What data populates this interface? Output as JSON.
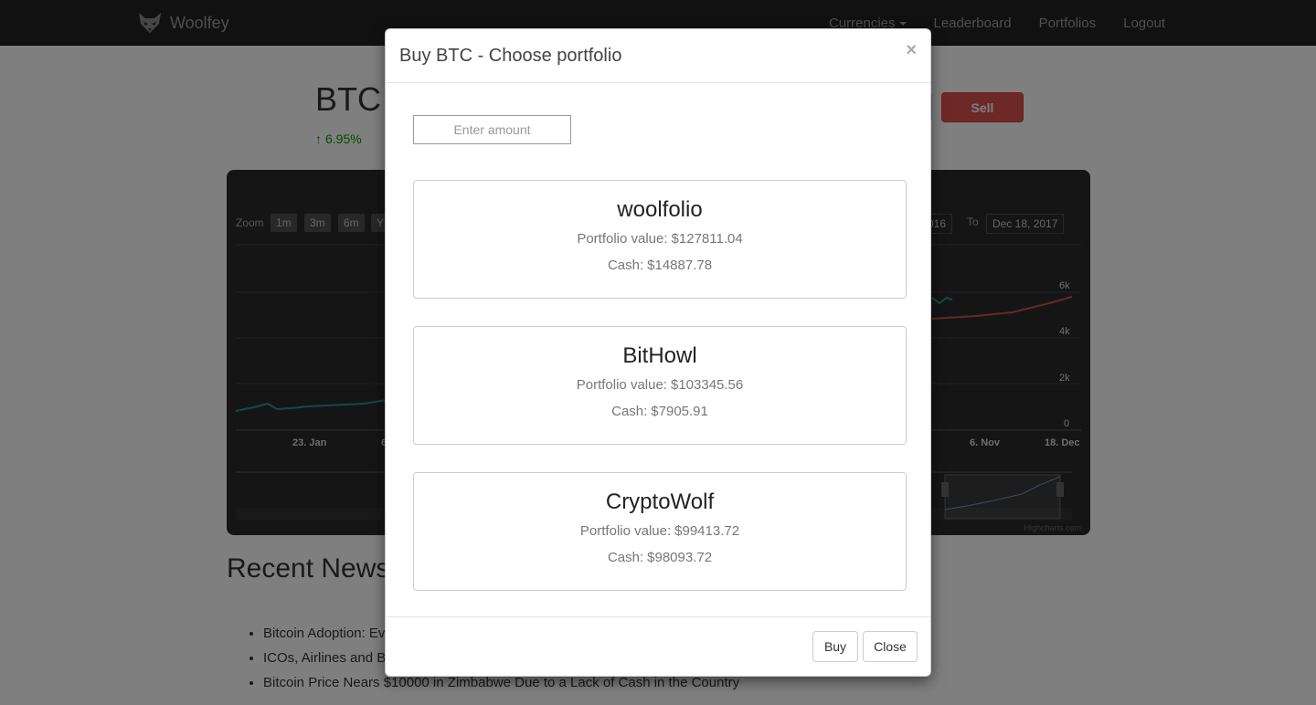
{
  "navbar": {
    "brand": "Woolfey",
    "links": {
      "currencies": "Currencies",
      "leaderboard": "Leaderboard",
      "portfolios": "Portfolios",
      "logout": "Logout"
    }
  },
  "page": {
    "ticker": "BTC",
    "change": "6.95%",
    "sell_label": "Sell",
    "chart": {
      "zoom_label": "Zoom",
      "zoom_buttons": [
        "1m",
        "3m",
        "6m",
        "Y"
      ],
      "from_date_visible": "016",
      "to_label": "To",
      "to_date": "Dec 18, 2017",
      "y_ticks": [
        "6k",
        "4k",
        "2k",
        "0"
      ],
      "x_ticks": [
        "23. Jan",
        "6",
        "6. Nov",
        "18. Dec"
      ],
      "credit": "Highcharts.com"
    },
    "news_title": "Recent News",
    "news": [
      "Bitcoin Adoption: Ev",
      "ICOs, Airlines and Bi",
      "Bitcoin Price Nears $10000 in Zimbabwe Due to a Lack of Cash in the Country"
    ]
  },
  "modal": {
    "title": "Buy BTC - Choose portfolio",
    "close_symbol": "×",
    "amount_placeholder": "Enter amount",
    "portfolios": [
      {
        "name": "woolfolio",
        "value_label": "Portfolio value:",
        "value": "$127811.04",
        "cash_label": "Cash:",
        "cash": "$14887.78"
      },
      {
        "name": "BitHowl",
        "value_label": "Portfolio value:",
        "value": "$103345.56",
        "cash_label": "Cash:",
        "cash": "$7905.91"
      },
      {
        "name": "CryptoWolf",
        "value_label": "Portfolio value:",
        "value": "$99413.72",
        "cash_label": "Cash:",
        "cash": "$98093.72"
      }
    ],
    "buy_label": "Buy",
    "close_label": "Close"
  }
}
